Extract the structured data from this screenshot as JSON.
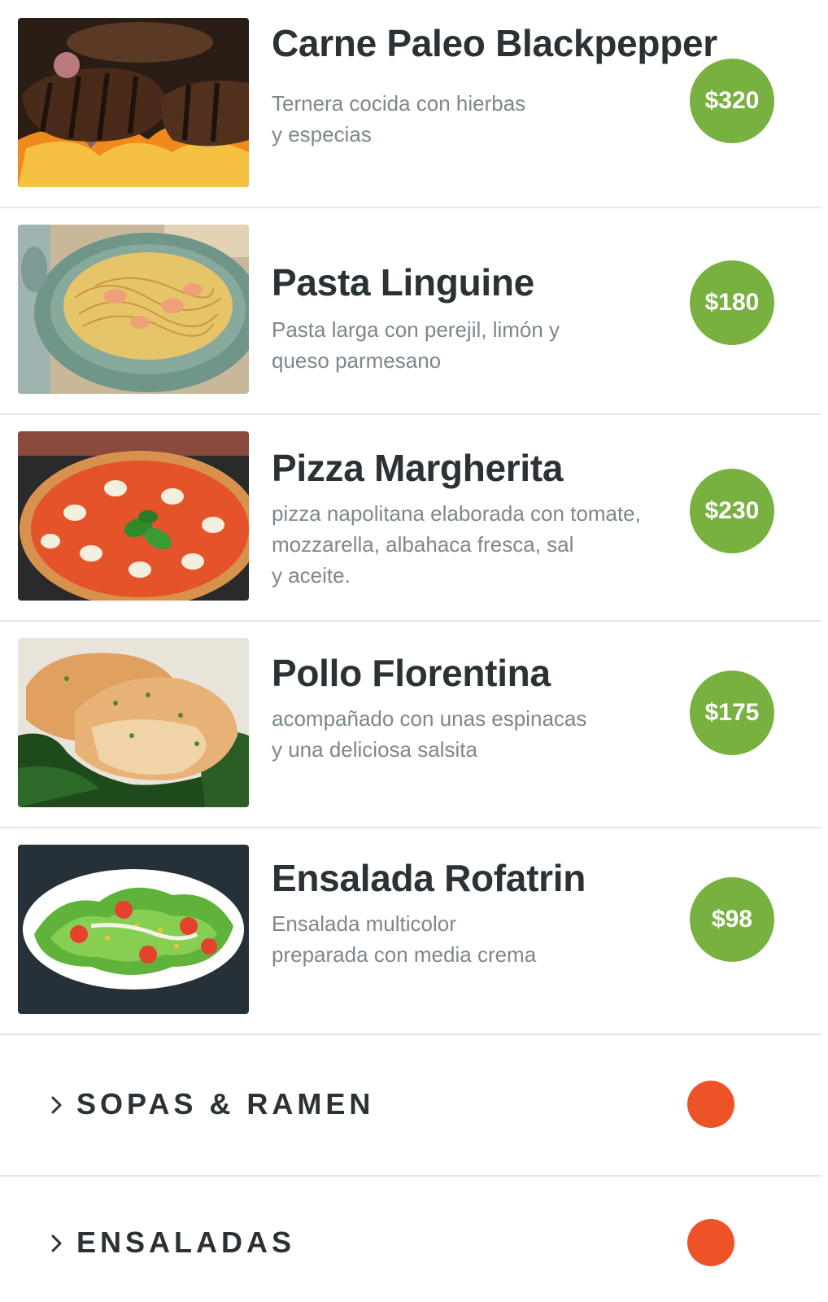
{
  "menu": {
    "items": [
      {
        "name": "Carne Paleo Blackpepper",
        "description": "Ternera cocida con hierbas\ny especias",
        "price": "$320",
        "image_icon": "grilled-steak-photo"
      },
      {
        "name": "Pasta Linguine",
        "description": "Pasta larga con perejil, limón y\nqueso parmesano",
        "price": "$180",
        "image_icon": "pasta-linguine-photo"
      },
      {
        "name": "Pizza Margherita",
        "description": "pizza napolitana elaborada con tomate,\n mozzarella, albahaca fresca, sal\ny aceite.",
        "price": "$230",
        "image_icon": "pizza-margherita-photo"
      },
      {
        "name": "Pollo Florentina",
        "description": "acompañado con unas espinacas\ny una deliciosa salsita",
        "price": "$175",
        "image_icon": "chicken-florentine-photo"
      },
      {
        "name": "Ensalada Rofatrin",
        "description": "Ensalada multicolor\npreparada con media crema",
        "price": "$98",
        "image_icon": "salad-photo"
      }
    ],
    "categories": [
      {
        "label": "SOPAS & RAMEN",
        "icon": "chevron-right-icon"
      },
      {
        "label": "ENSALADAS",
        "icon": "chevron-right-icon"
      }
    ]
  },
  "colors": {
    "price_badge": "#78b140",
    "category_dot": "#ee5227",
    "title_text": "#2a3235",
    "description_text": "#7d878c",
    "divider": "#e6e6e6"
  }
}
